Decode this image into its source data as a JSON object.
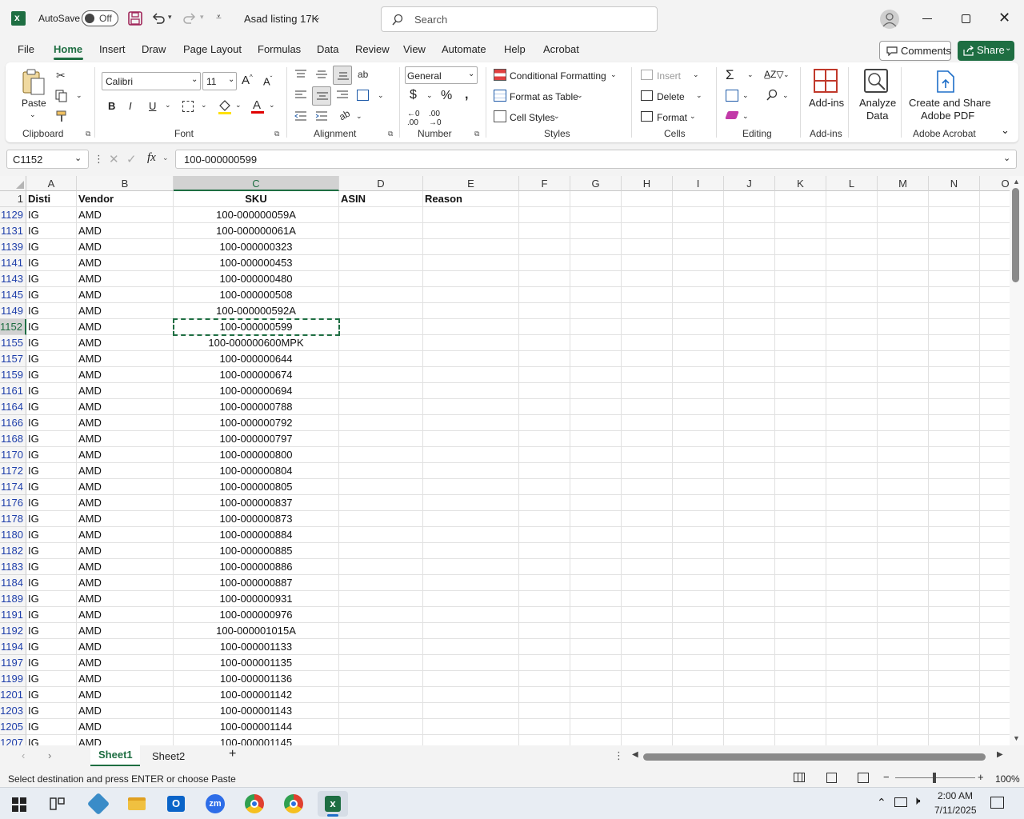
{
  "titlebar": {
    "autosave_label": "AutoSave",
    "autosave_state": "Off",
    "file_name": "Asad listing 17K",
    "search_placeholder": "Search"
  },
  "tabs": [
    "File",
    "Home",
    "Insert",
    "Draw",
    "Page Layout",
    "Formulas",
    "Data",
    "Review",
    "View",
    "Automate",
    "Help",
    "Acrobat"
  ],
  "active_tab": "Home",
  "buttons": {
    "comments": "Comments",
    "share": "Share"
  },
  "ribbon": {
    "clipboard": {
      "label": "Clipboard",
      "paste": "Paste"
    },
    "font": {
      "label": "Font",
      "family": "Calibri",
      "size": "11"
    },
    "alignment": {
      "label": "Alignment"
    },
    "number": {
      "label": "Number",
      "format": "General"
    },
    "styles": {
      "label": "Styles",
      "conditional_formatting": "Conditional Formatting",
      "format_as_table": "Format as Table",
      "cell_styles": "Cell Styles"
    },
    "cells": {
      "label": "Cells",
      "insert": "Insert",
      "delete": "Delete",
      "format": "Format"
    },
    "editing": {
      "label": "Editing"
    },
    "addins": {
      "label": "Add-ins",
      "button": "Add-ins"
    },
    "analyze": {
      "line1": "Analyze",
      "line2": "Data"
    },
    "acrobat": {
      "label": "Adobe Acrobat",
      "line1": "Create and Share",
      "line2": "Adobe PDF"
    }
  },
  "formula_bar": {
    "name_box": "C1152",
    "value": "100-000000599"
  },
  "columns": [
    "A",
    "B",
    "C",
    "D",
    "E",
    "F",
    "G",
    "H",
    "I",
    "J",
    "K",
    "L",
    "M",
    "N",
    "O"
  ],
  "header_row": {
    "row": "1",
    "cells": [
      "Disti",
      "Vendor",
      "SKU",
      "ASIN",
      "Reason"
    ]
  },
  "rows": [
    {
      "row": "1129",
      "disti": "IG",
      "vendor": "AMD",
      "sku": "100-000000059A"
    },
    {
      "row": "1131",
      "disti": "IG",
      "vendor": "AMD",
      "sku": "100-000000061A"
    },
    {
      "row": "1139",
      "disti": "IG",
      "vendor": "AMD",
      "sku": "100-000000323"
    },
    {
      "row": "1141",
      "disti": "IG",
      "vendor": "AMD",
      "sku": "100-000000453"
    },
    {
      "row": "1143",
      "disti": "IG",
      "vendor": "AMD",
      "sku": "100-000000480"
    },
    {
      "row": "1145",
      "disti": "IG",
      "vendor": "AMD",
      "sku": "100-000000508"
    },
    {
      "row": "1149",
      "disti": "IG",
      "vendor": "AMD",
      "sku": "100-000000592A"
    },
    {
      "row": "1152",
      "disti": "IG",
      "vendor": "AMD",
      "sku": "100-000000599"
    },
    {
      "row": "1155",
      "disti": "IG",
      "vendor": "AMD",
      "sku": "100-000000600MPK"
    },
    {
      "row": "1157",
      "disti": "IG",
      "vendor": "AMD",
      "sku": "100-000000644"
    },
    {
      "row": "1159",
      "disti": "IG",
      "vendor": "AMD",
      "sku": "100-000000674"
    },
    {
      "row": "1161",
      "disti": "IG",
      "vendor": "AMD",
      "sku": "100-000000694"
    },
    {
      "row": "1164",
      "disti": "IG",
      "vendor": "AMD",
      "sku": "100-000000788"
    },
    {
      "row": "1166",
      "disti": "IG",
      "vendor": "AMD",
      "sku": "100-000000792"
    },
    {
      "row": "1168",
      "disti": "IG",
      "vendor": "AMD",
      "sku": "100-000000797"
    },
    {
      "row": "1170",
      "disti": "IG",
      "vendor": "AMD",
      "sku": "100-000000800"
    },
    {
      "row": "1172",
      "disti": "IG",
      "vendor": "AMD",
      "sku": "100-000000804"
    },
    {
      "row": "1174",
      "disti": "IG",
      "vendor": "AMD",
      "sku": "100-000000805"
    },
    {
      "row": "1176",
      "disti": "IG",
      "vendor": "AMD",
      "sku": "100-000000837"
    },
    {
      "row": "1178",
      "disti": "IG",
      "vendor": "AMD",
      "sku": "100-000000873"
    },
    {
      "row": "1180",
      "disti": "IG",
      "vendor": "AMD",
      "sku": "100-000000884"
    },
    {
      "row": "1182",
      "disti": "IG",
      "vendor": "AMD",
      "sku": "100-000000885"
    },
    {
      "row": "1183",
      "disti": "IG",
      "vendor": "AMD",
      "sku": "100-000000886"
    },
    {
      "row": "1184",
      "disti": "IG",
      "vendor": "AMD",
      "sku": "100-000000887"
    },
    {
      "row": "1189",
      "disti": "IG",
      "vendor": "AMD",
      "sku": "100-000000931"
    },
    {
      "row": "1191",
      "disti": "IG",
      "vendor": "AMD",
      "sku": "100-000000976"
    },
    {
      "row": "1192",
      "disti": "IG",
      "vendor": "AMD",
      "sku": "100-000001015A"
    },
    {
      "row": "1194",
      "disti": "IG",
      "vendor": "AMD",
      "sku": "100-000001133"
    },
    {
      "row": "1197",
      "disti": "IG",
      "vendor": "AMD",
      "sku": "100-000001135"
    },
    {
      "row": "1199",
      "disti": "IG",
      "vendor": "AMD",
      "sku": "100-000001136"
    },
    {
      "row": "1201",
      "disti": "IG",
      "vendor": "AMD",
      "sku": "100-000001142"
    },
    {
      "row": "1203",
      "disti": "IG",
      "vendor": "AMD",
      "sku": "100-000001143"
    },
    {
      "row": "1205",
      "disti": "IG",
      "vendor": "AMD",
      "sku": "100-000001144"
    },
    {
      "row": "1207",
      "disti": "IG",
      "vendor": "AMD",
      "sku": "100-000001145"
    }
  ],
  "selected_row": "1152",
  "sheets": [
    "Sheet1",
    "Sheet2"
  ],
  "active_sheet": "Sheet1",
  "status": {
    "message": "Select destination and press ENTER or choose Paste",
    "zoom": "100%"
  },
  "taskbar": {
    "time": "2:00 AM",
    "date": "7/11/2025"
  },
  "colors": {
    "accent": "#1e6e42",
    "row_number_blue": "#1f3faa"
  }
}
